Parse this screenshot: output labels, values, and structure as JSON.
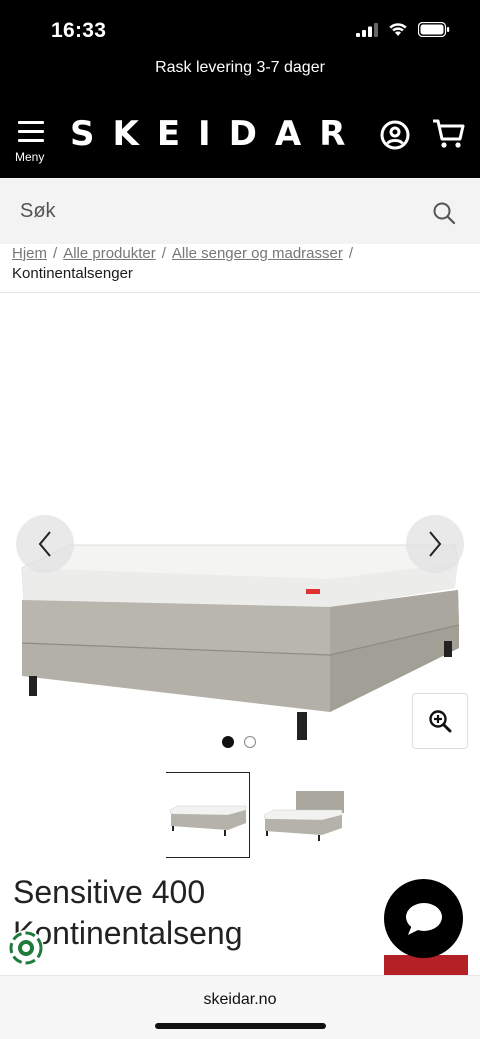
{
  "status": {
    "time": "16:33"
  },
  "promo": {
    "text": "Rask levering 3-7 dager"
  },
  "header": {
    "menu_label": "Meny",
    "logo": "SKEIDAR"
  },
  "search": {
    "placeholder": "Søk"
  },
  "breadcrumb": {
    "items": [
      "Hjem",
      "Alle produkter",
      "Alle senger og madrasser"
    ],
    "current": "Kontinentalsenger"
  },
  "gallery": {
    "image_count": 2,
    "active_index": 1
  },
  "product": {
    "title_line1": "Sensitive 400",
    "title_line2": "Kontinentalseng"
  },
  "browser": {
    "url": "skeidar.no"
  },
  "colors": {
    "brand_black": "#000000",
    "accent_red": "#b32025",
    "search_bg": "#f3f3f3"
  },
  "icons": [
    "signal-icon",
    "wifi-icon",
    "battery-icon",
    "menu-icon",
    "user-icon",
    "cart-icon",
    "search-icon",
    "chevron-left-icon",
    "chevron-right-icon",
    "zoom-in-icon",
    "chat-icon"
  ]
}
